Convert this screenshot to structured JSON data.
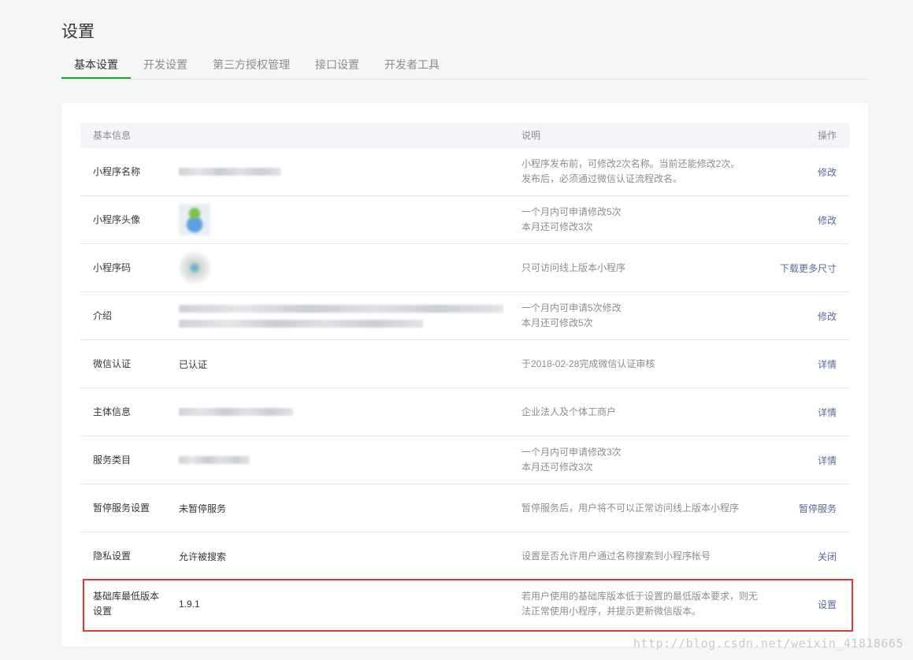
{
  "page": {
    "title": "设置"
  },
  "tabs": [
    {
      "label": "基本设置",
      "active": true
    },
    {
      "label": "开发设置",
      "active": false
    },
    {
      "label": "第三方授权管理",
      "active": false
    },
    {
      "label": "接口设置",
      "active": false
    },
    {
      "label": "开发者工具",
      "active": false
    }
  ],
  "table": {
    "headers": {
      "info": "基本信息",
      "desc": "说明",
      "op": "操作"
    },
    "rows": [
      {
        "label": "小程序名称",
        "value": "",
        "desc": "小程序发布前，可修改2次名称。当前还能修改2次。\n发布后，必须通过微信认证流程改名。",
        "desc1": "小程序发布前，可修改2次名称。当前还能修改2次。",
        "desc2": "发布后，必须通过微信认证流程改名。",
        "op": "修改"
      },
      {
        "label": "小程序头像",
        "value": "",
        "desc1": "一个月内可申请修改5次",
        "desc2": "本月还可修改3次",
        "op": "修改"
      },
      {
        "label": "小程序码",
        "value": "",
        "desc1": "只可访问线上版本小程序",
        "desc2": "",
        "op": "下载更多尺寸"
      },
      {
        "label": "介绍",
        "value": "",
        "desc1": "一个月内可申请5次修改",
        "desc2": "本月还可修改5次",
        "op": "修改"
      },
      {
        "label": "微信认证",
        "value": "已认证",
        "desc1": "于2018-02-28完成微信认证审核",
        "desc2": "",
        "op": "详情"
      },
      {
        "label": "主体信息",
        "value": "",
        "desc1": "企业法人及个体工商户",
        "desc2": "",
        "op": "详情"
      },
      {
        "label": "服务类目",
        "value": "",
        "desc1": "一个月内可申请修改3次",
        "desc2": "本月还可修改3次",
        "op": "详情"
      },
      {
        "label": "暂停服务设置",
        "value": "未暂停服务",
        "desc1": "暂停服务后，用户将不可以正常访问线上版本小程序",
        "desc2": "",
        "op": "暂停服务"
      },
      {
        "label": "隐私设置",
        "value": "允许被搜索",
        "desc1": "设置是否允许用户通过名称搜索到小程序帐号",
        "desc2": "",
        "op": "关闭"
      },
      {
        "label": "基础库最低版本设置",
        "label1": "基础库最低版本",
        "label2": "设置",
        "value": "1.9.1",
        "desc1": "若用户使用的基础库版本低于设置的最低版本要求，则无",
        "desc2": "法正常使用小程序，并提示更新微信版本。",
        "op": "设置"
      }
    ]
  },
  "watermark": "http://blog.csdn.net/weixin_41818665",
  "colors": {
    "accent": "#1aad19",
    "link": "#576b95",
    "highlight": "#e3393c"
  }
}
